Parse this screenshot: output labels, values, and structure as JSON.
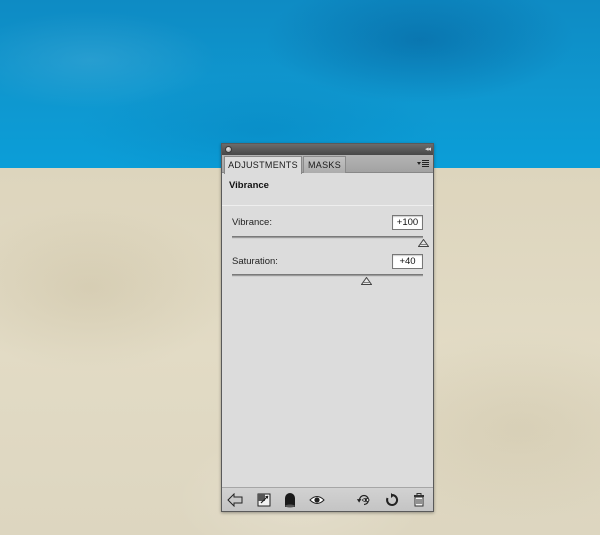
{
  "colors": {
    "sky": "#0f97cf",
    "paper": "#e2dbc5",
    "panel": "#dcdcdc"
  },
  "window": {
    "close_icon": "close-dot-icon",
    "collapse_icon": "double-chevron-right-icon",
    "collapse_glyph": "◂◂"
  },
  "tabs": [
    {
      "label": "ADJUSTMENTS",
      "active": true
    },
    {
      "label": "MASKS",
      "active": false
    }
  ],
  "panel_menu_icon": "panel-menu-icon",
  "adjustment": {
    "title": "Vibrance",
    "sliders": [
      {
        "label": "Vibrance:",
        "value": "+100",
        "level": 100,
        "min": -100,
        "max": 100
      },
      {
        "label": "Saturation:",
        "value": "+40",
        "level": 40,
        "min": -100,
        "max": 100
      }
    ]
  },
  "footer": {
    "buttons": [
      "return-arrow-icon",
      "clip-to-layer-icon",
      "layer-visibility-shape-icon",
      "view-previous-eye-icon",
      "toggle-visibility-icon",
      "reset-icon",
      "trash-icon"
    ]
  }
}
